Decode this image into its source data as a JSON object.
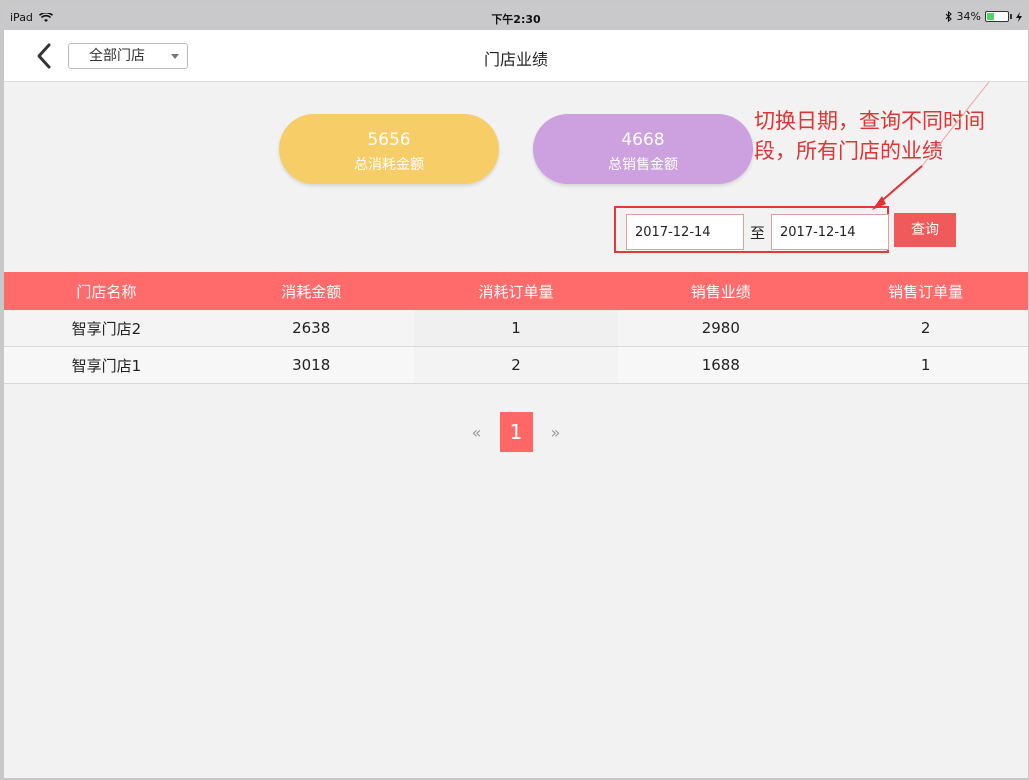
{
  "status_bar": {
    "device": "iPad",
    "time": "下午2:30",
    "battery_percent": "34%",
    "battery_level": 0.34
  },
  "nav": {
    "store_selector": "全部门店",
    "title": "门店业绩"
  },
  "summary": {
    "consumption_total": "5656",
    "consumption_label": "总消耗金额",
    "sales_total": "4668",
    "sales_label": "总销售金额"
  },
  "annotation": "切换日期，查询不同时间段，所有门店的业绩",
  "filter": {
    "date_from": "2017-12-14",
    "separator": "至",
    "date_to": "2017-12-14",
    "query_label": "查询"
  },
  "table": {
    "headers": [
      "门店名称",
      "消耗金额",
      "消耗订单量",
      "销售业绩",
      "销售订单量"
    ],
    "rows": [
      [
        "智享门店2",
        "2638",
        "1",
        "2980",
        "2"
      ],
      [
        "智享门店1",
        "3018",
        "2",
        "1688",
        "1"
      ]
    ]
  },
  "pagination": {
    "prev": "«",
    "current": "1",
    "next": "»"
  },
  "colors": {
    "accent_red": "#ff6a6a",
    "pill_yellow": "#f7cd68",
    "pill_purple": "#cda0e0",
    "annotation_red": "#e03333"
  }
}
